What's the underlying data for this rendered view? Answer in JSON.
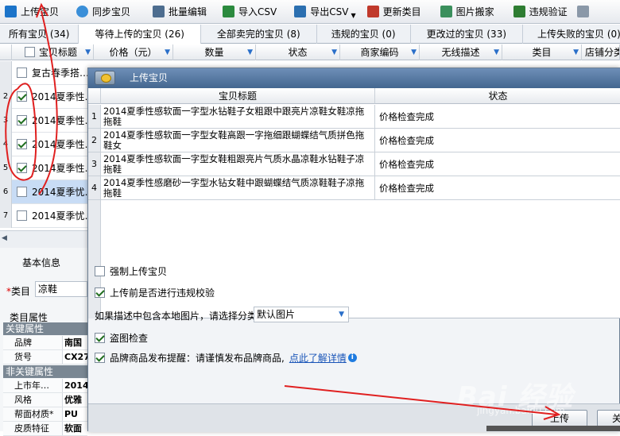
{
  "toolbar": {
    "buttons": [
      {
        "label": "上传宝贝",
        "icon": "upload-icon",
        "color": "#1c74c9"
      },
      {
        "label": "同步宝贝",
        "icon": "sync-icon",
        "color": "#3a8fd8"
      },
      {
        "label": "批量编辑",
        "icon": "batch-edit-icon",
        "color": "#4d6d8f"
      },
      {
        "label": "导入CSV",
        "icon": "import-csv-icon",
        "color": "#2b8a3e"
      },
      {
        "label": "导出CSV",
        "icon": "export-csv-icon",
        "color": "#2b6fb0"
      },
      {
        "label": "更新类目",
        "icon": "update-category-icon",
        "color": "#c0392b"
      },
      {
        "label": "图片搬家",
        "icon": "image-move-icon",
        "color": "#3a8f5c"
      },
      {
        "label": "违规验证",
        "icon": "violation-check-icon",
        "color": "#2e7d32"
      }
    ]
  },
  "tabs": [
    "所有宝贝 (34)",
    "等待上传的宝贝 (26)",
    "全部卖完的宝贝 (8)",
    "违规的宝贝 (0)",
    "更改过的宝贝 (33)",
    "上传失败的宝贝 (0)"
  ],
  "grid": {
    "columns": [
      "宝贝标题",
      "价格（元）",
      "数量",
      "状态",
      "商家编码",
      "无线描述",
      "类目",
      "店铺分类"
    ],
    "rows": [
      {
        "num": "",
        "title": "复古春季搭…",
        "checked": false
      },
      {
        "num": "2",
        "title": "2014夏季性…",
        "checked": true
      },
      {
        "num": "3",
        "title": "2014夏季性…",
        "checked": true
      },
      {
        "num": "4",
        "title": "2014夏季性…",
        "checked": true
      },
      {
        "num": "5",
        "title": "2014夏季性…",
        "checked": true
      },
      {
        "num": "6",
        "title": "2014夏季忧…",
        "checked": false
      },
      {
        "num": "7",
        "title": "2014夏季忧…",
        "checked": false
      }
    ]
  },
  "left_panel": {
    "basic_info": "基本信息",
    "category_label": "类目",
    "required_mark": "*",
    "category_value": "凉鞋",
    "attributes_label": "类目属性",
    "key_section": "关键属性",
    "key_attrs": [
      {
        "k": "品牌",
        "v": "南国"
      },
      {
        "k": "货号",
        "v": "CX27"
      }
    ],
    "nonkey_section": "非关键属性",
    "nonkey_attrs": [
      {
        "k": "上市年…",
        "v": "2014"
      },
      {
        "k": "风格",
        "v": "优雅"
      },
      {
        "k": "帮面材质*",
        "v": "PU"
      },
      {
        "k": "皮质特征",
        "v": "软面"
      }
    ]
  },
  "dialog": {
    "title": "上传宝贝",
    "col_title": "宝贝标题",
    "col_status": "状态",
    "rows": [
      {
        "n": "1",
        "title": "2014夏季性感软面一字型水钻鞋子女粗跟中跟亮片凉鞋女鞋凉拖拖鞋",
        "status": "价格检查完成"
      },
      {
        "n": "2",
        "title": "2014夏季性感软面一字型女鞋高跟一字拖细跟蝴蝶结气质拼色拖鞋女",
        "status": "价格检查完成"
      },
      {
        "n": "3",
        "title": "2014夏季性感软面一字型女鞋粗跟亮片气质水晶凉鞋水钻鞋子凉拖鞋",
        "status": "价格检查完成"
      },
      {
        "n": "4",
        "title": "2014夏季性感磨砂一字型水钻女鞋中跟蝴蝶结气质凉鞋鞋子凉拖拖鞋",
        "status": "价格检查完成"
      }
    ],
    "force_upload": "强制上传宝贝",
    "pre_check": "上传前是否进行违规校验",
    "image_category_prompt": "如果描述中包含本地图片，请选择分类",
    "image_category_value": "默认图片",
    "piracy_check": "盗图检查",
    "brand_notice": "品牌商品发布提醒：请谨慎发布品牌商品,",
    "brand_link": "点此了解详情",
    "upload_button": "上传",
    "close_button": "关"
  },
  "watermark": {
    "main": "Bai 经验",
    "sub": "jingyan.baidu.com"
  },
  "colors": {
    "annotation": "#e02020",
    "dialog_title": "#44678f",
    "link": "#1a55b8"
  }
}
